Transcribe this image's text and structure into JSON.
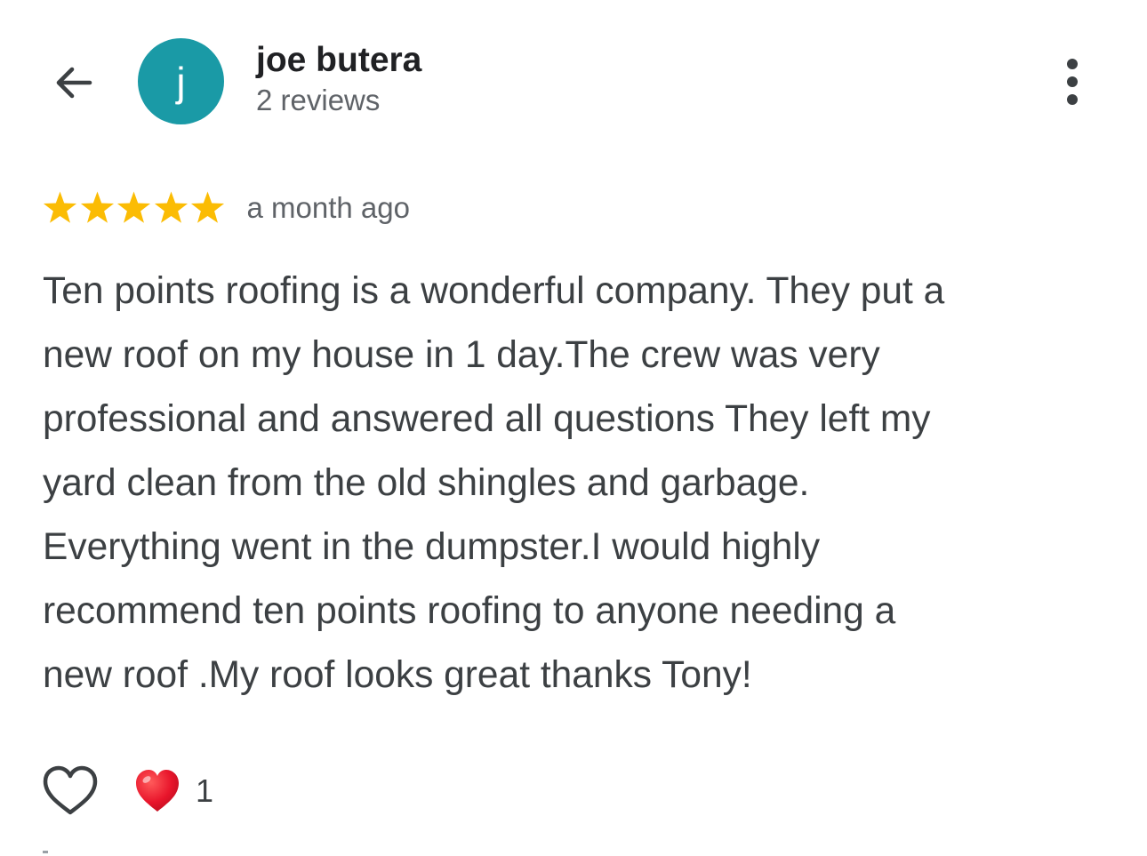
{
  "header": {
    "back_icon": "arrow-left-icon",
    "avatar_initial": "j",
    "avatar_color": "#1a9aa6",
    "author_name": "joe butera",
    "review_count": "2 reviews",
    "more_icon": "more-vertical-icon"
  },
  "review": {
    "rating": 5,
    "rating_max": 5,
    "star_color": "#fbbc04",
    "date": "a month ago",
    "text": "Ten points roofing is a wonderful company. They put a\nnew roof on my house in 1 day.The crew was very\nprofessional and answered all questions They left my\nyard clean from the old shingles and garbage.\nEverything went in the dumpster.I would highly\nrecommend ten points roofing to anyone needing a\nnew roof .My roof looks great thanks Tony!"
  },
  "reactions": {
    "like_icon": "heart-outline-icon",
    "reaction_icon": "red-heart-icon",
    "reaction_count": "1"
  }
}
